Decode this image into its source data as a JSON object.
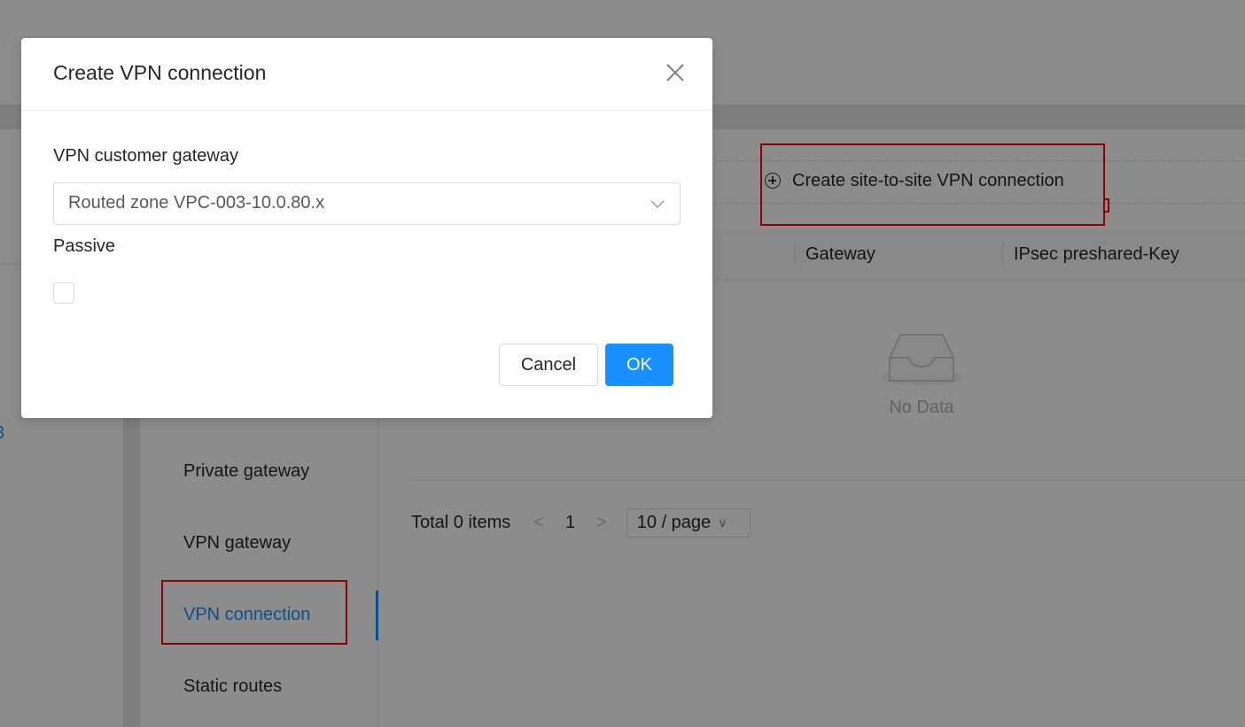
{
  "background": {
    "left_panel_link": "3",
    "create_button_label": "Create site-to-site VPN connection",
    "table": {
      "columns": [
        "Gateway",
        "IPsec preshared-Key"
      ],
      "empty_text": "No Data"
    },
    "submenu": {
      "items": [
        "Private gateway",
        "VPN gateway",
        "VPN connection",
        "Static routes"
      ],
      "active_item": "VPN connection"
    },
    "pagination": {
      "total": "Total 0 items",
      "current_page": "1",
      "page_size": "10 / page",
      "prev_icon": "chevron-left-icon",
      "next_icon": "chevron-right-icon"
    }
  },
  "modal": {
    "title": "Create VPN connection",
    "close_icon": "close-icon",
    "customer_gateway": {
      "label": "VPN customer gateway",
      "value": "Routed zone VPC-003-10.0.80.x"
    },
    "passive": {
      "label": "Passive",
      "checked": false
    },
    "cancel_label": "Cancel",
    "ok_label": "OK"
  },
  "colors": {
    "primary": "#1890ff",
    "highlight_box": "#ff0000",
    "mask": "rgba(0,0,0,0.45)"
  }
}
